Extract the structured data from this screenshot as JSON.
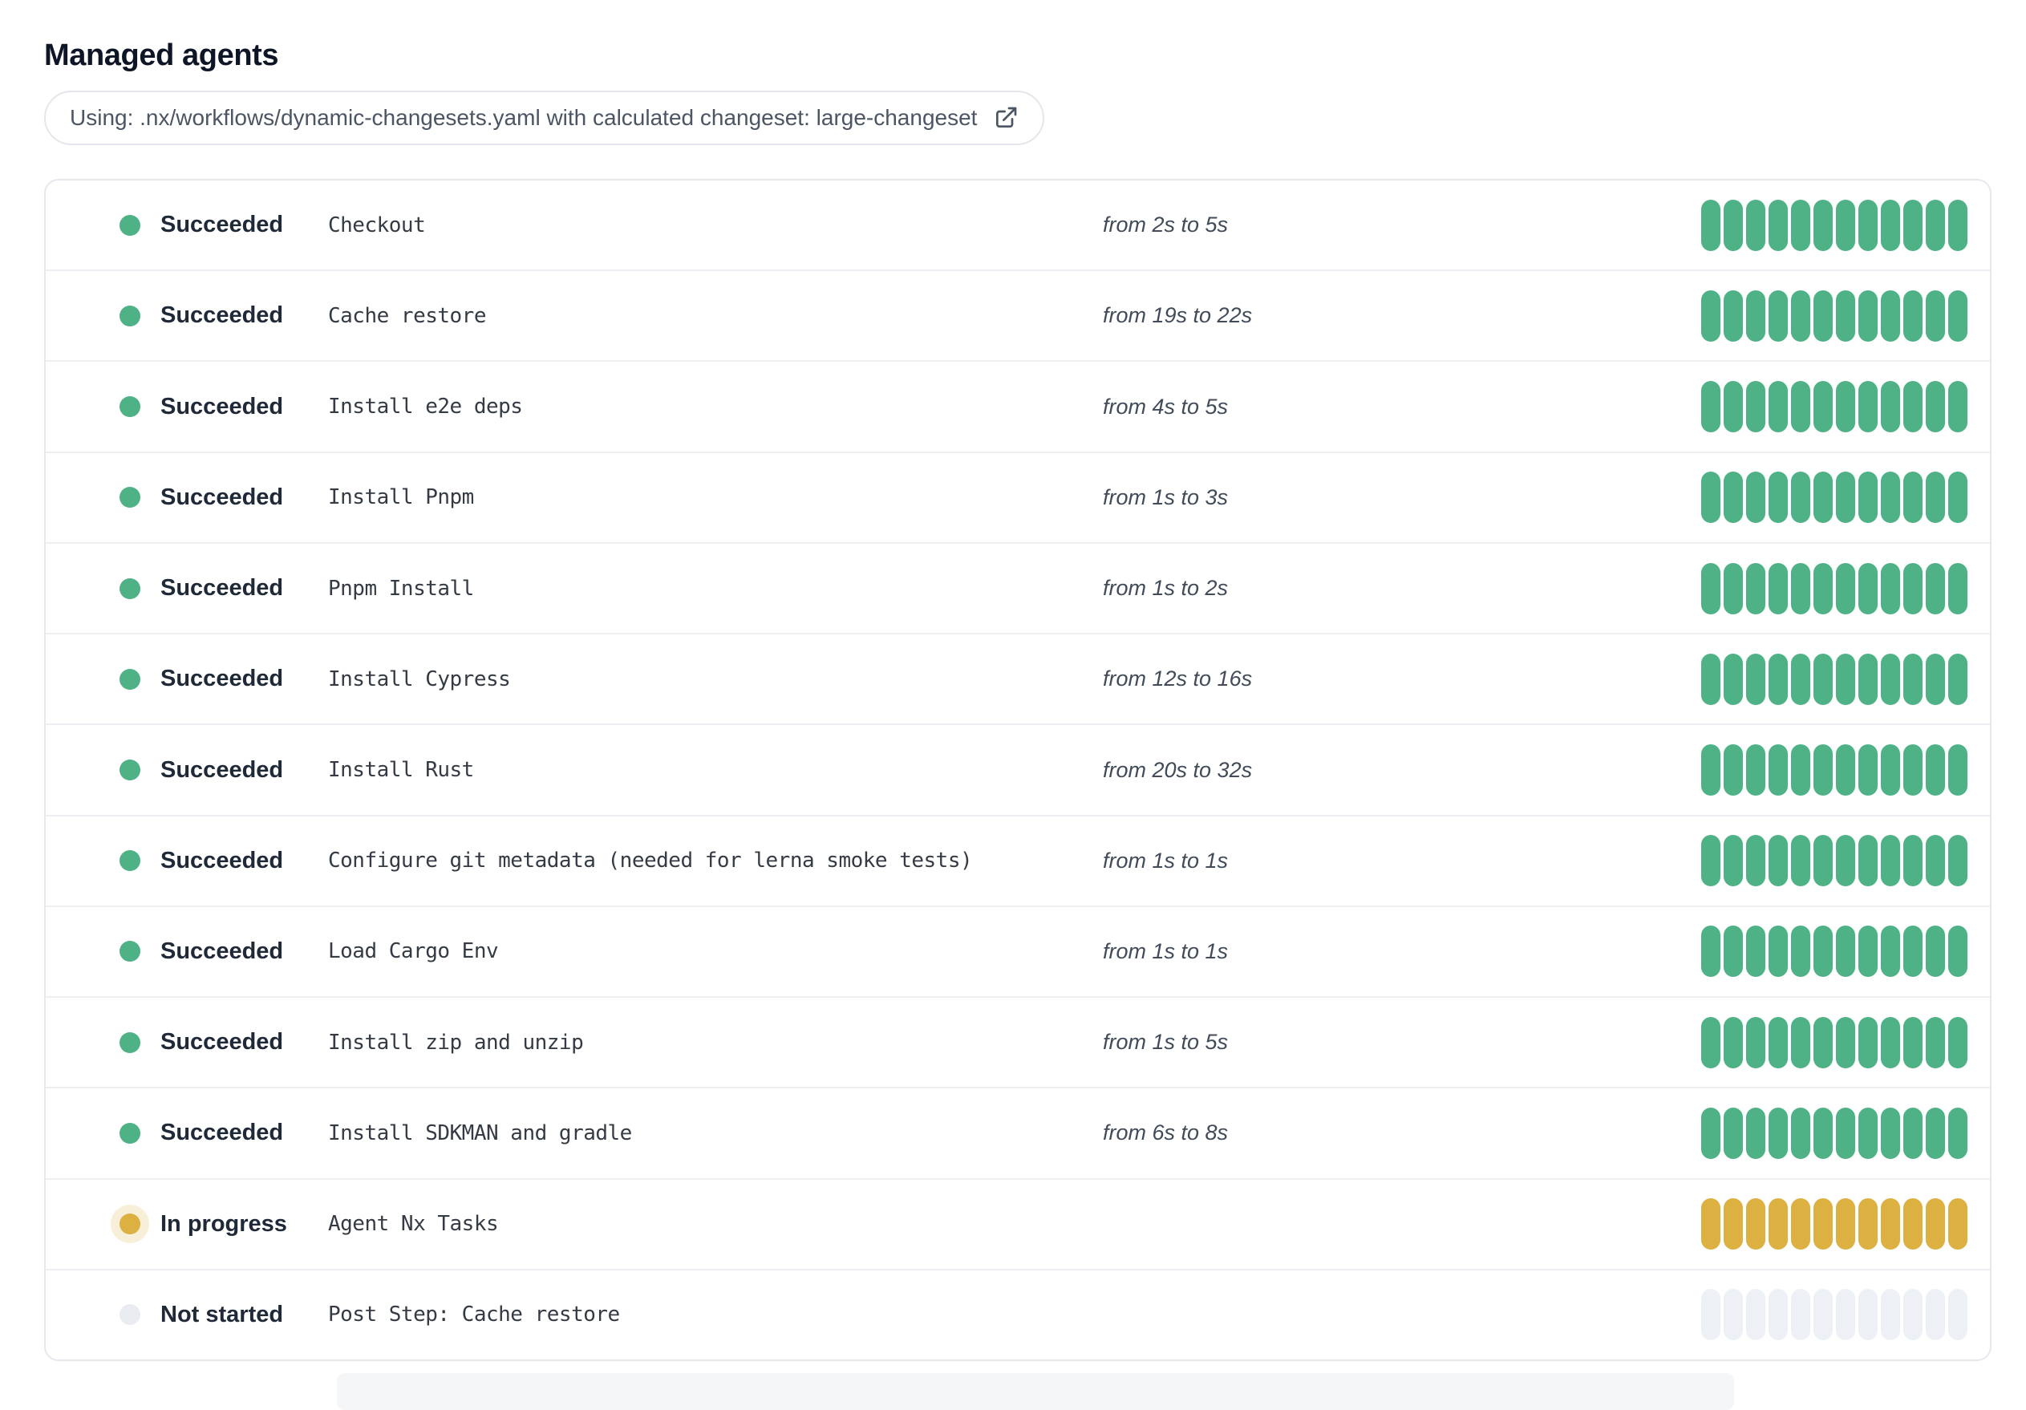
{
  "page": {
    "title": "Managed agents"
  },
  "banner": {
    "text": "Using: .nx/workflows/dynamic-changesets.yaml with calculated changeset: large-changeset",
    "icon": "external-link-icon"
  },
  "agents_per_row": 12,
  "colors": {
    "title_text": "#0d1526",
    "succeeded": "#4fb287",
    "in_progress": "#ddb042",
    "in_progress_halo": "rgba(221, 176, 66, 0.20)",
    "not_started_bar": "#edf1f5",
    "not_started_dot": "#e9edf2"
  },
  "steps": [
    {
      "status": "Succeeded",
      "status_key": "succeeded",
      "name": "Checkout",
      "duration": "from 2s to 5s"
    },
    {
      "status": "Succeeded",
      "status_key": "succeeded",
      "name": "Cache restore",
      "duration": "from 19s to 22s"
    },
    {
      "status": "Succeeded",
      "status_key": "succeeded",
      "name": "Install e2e deps",
      "duration": "from 4s to 5s"
    },
    {
      "status": "Succeeded",
      "status_key": "succeeded",
      "name": "Install Pnpm",
      "duration": "from 1s to 3s"
    },
    {
      "status": "Succeeded",
      "status_key": "succeeded",
      "name": "Pnpm Install",
      "duration": "from 1s to 2s"
    },
    {
      "status": "Succeeded",
      "status_key": "succeeded",
      "name": "Install Cypress",
      "duration": "from 12s to 16s"
    },
    {
      "status": "Succeeded",
      "status_key": "succeeded",
      "name": "Install Rust",
      "duration": "from 20s to 32s"
    },
    {
      "status": "Succeeded",
      "status_key": "succeeded",
      "name": "Configure git metadata (needed for lerna smoke tests)",
      "duration": "from 1s to 1s"
    },
    {
      "status": "Succeeded",
      "status_key": "succeeded",
      "name": "Load Cargo Env",
      "duration": "from 1s to 1s"
    },
    {
      "status": "Succeeded",
      "status_key": "succeeded",
      "name": "Install zip and unzip",
      "duration": "from 1s to 5s"
    },
    {
      "status": "Succeeded",
      "status_key": "succeeded",
      "name": "Install SDKMAN and gradle",
      "duration": "from 6s to 8s"
    },
    {
      "status": "In progress",
      "status_key": "in-progress",
      "name": "Agent Nx Tasks",
      "duration": ""
    },
    {
      "status": "Not started",
      "status_key": "not-started",
      "name": "Post Step: Cache restore",
      "duration": ""
    }
  ]
}
